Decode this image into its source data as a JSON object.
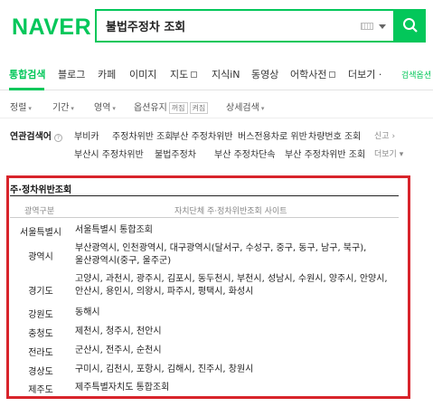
{
  "header": {
    "logo": "NAVER",
    "query": "불법주정차 조회"
  },
  "tabs": [
    {
      "label": "통합검색",
      "active": true
    },
    {
      "label": "블로그"
    },
    {
      "label": "카페"
    },
    {
      "label": "이미지"
    },
    {
      "label": "지도"
    },
    {
      "label": "지식iN"
    },
    {
      "label": "동영상"
    },
    {
      "label": "어학사전"
    },
    {
      "label": "더보기 ·"
    },
    {
      "label": "검색옵션"
    }
  ],
  "filters": {
    "sort": "정렬",
    "period": "기간",
    "area": "영역",
    "option": "옵션유지",
    "chip_on": "꺼짐",
    "chip_off": "켜짐",
    "detail": "상세검색"
  },
  "related": {
    "title": "연관검색어",
    "help": "?",
    "row1": [
      "부비카",
      "주정차위반 조회",
      "부산 주정차위반",
      "버스전용차로 위반",
      "차량번호 조회"
    ],
    "row2": [
      "부산시 주정차위반",
      "불법주정차",
      "부산 주정차단속",
      "부산 주정차위반 조회"
    ],
    "report": "신고",
    "more": "더보기"
  },
  "table": {
    "title": "주·정차위반조회",
    "col_region": "광역구분",
    "col_sites": "자치단체 주·정차위반조회 사이트",
    "rows": [
      {
        "region": "서울특별시",
        "cities": [
          "서울특별시 통합조회"
        ]
      },
      {
        "region": "광역시",
        "cities": [
          "부산광역시, 인천광역시, 대구광역시(달서구, 수성구, 중구, 동구, 남구, 북구),",
          "울산광역시(중구, 울주군)"
        ]
      },
      {
        "region": "경기도",
        "cities": [
          "고양시, 과천시, 광주시, 김포시, 동두천시, 부천시, 성남시, 수원시, 양주시, 안양시,",
          "안산시, 용인시, 의왕시, 파주시, 평택시, 화성시"
        ]
      },
      {
        "region": "강원도",
        "cities": [
          "동해시"
        ]
      },
      {
        "region": "충청도",
        "cities": [
          "제천시, 청주시, 천안시"
        ]
      },
      {
        "region": "전라도",
        "cities": [
          "군산시, 전주시, 순천시"
        ]
      },
      {
        "region": "경상도",
        "cities": [
          "구미시, 김천시, 포항시, 김해시, 진주시, 창원시"
        ]
      },
      {
        "region": "제주도",
        "cities": [
          "제주특별자치도 통합조회"
        ]
      }
    ]
  },
  "colors": {
    "brand": "#03c75a",
    "highlight": "#d8242b"
  }
}
